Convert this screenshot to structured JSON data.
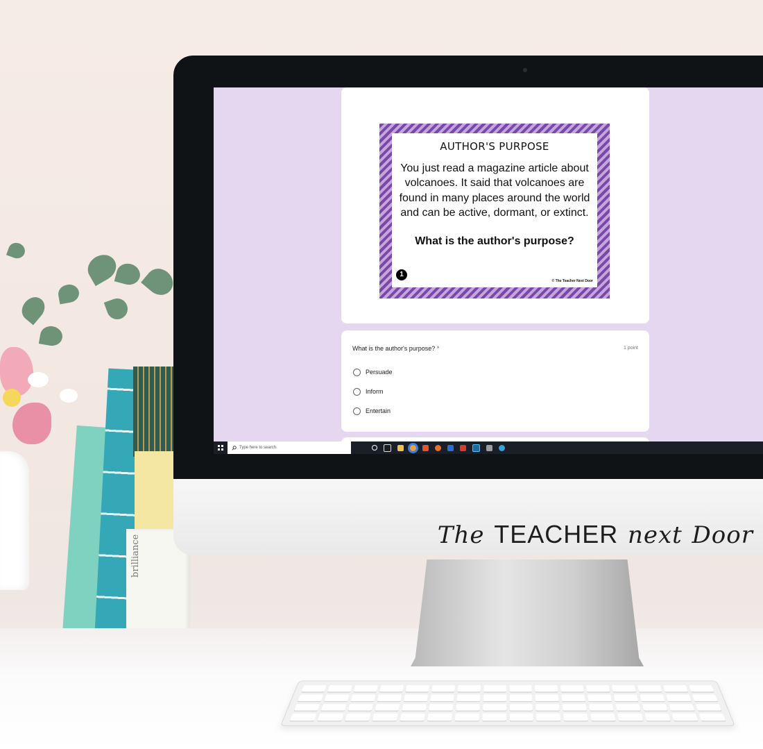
{
  "poster": {
    "title": "AUTHOR'S PURPOSE",
    "body": "You just read a magazine article about volcanoes. It said that volcanoes are found in many places around the world and can be active, dormant, or extinct.",
    "question": "What is the author's purpose?",
    "number": "1",
    "copyright": "© The Teacher Next Door"
  },
  "question": {
    "title": "What is the author's purpose?",
    "required_mark": "*",
    "points": "1 point",
    "options": [
      "Persuade",
      "Inform",
      "Entertain"
    ]
  },
  "taskbar": {
    "search_placeholder": "Type here to search",
    "apps": [
      "cortana-icon",
      "task-view-icon",
      "file-explorer-icon",
      "chrome-icon",
      "office-icon",
      "firefox-icon",
      "word-icon",
      "acrobat-icon",
      "photoshop-icon",
      "printer-icon",
      "edge-icon"
    ]
  },
  "monitor": {
    "brand_the": "The",
    "brand_teacher": "TEACHER",
    "brand_next": "next",
    "brand_door": "Door"
  },
  "book": {
    "spine": "brilliance"
  },
  "colors": {
    "screen_background": "#e6d7f0",
    "poster_stripe_dark": "#7b48a8",
    "poster_stripe_light": "#c4a6df",
    "required": "#d93025"
  }
}
